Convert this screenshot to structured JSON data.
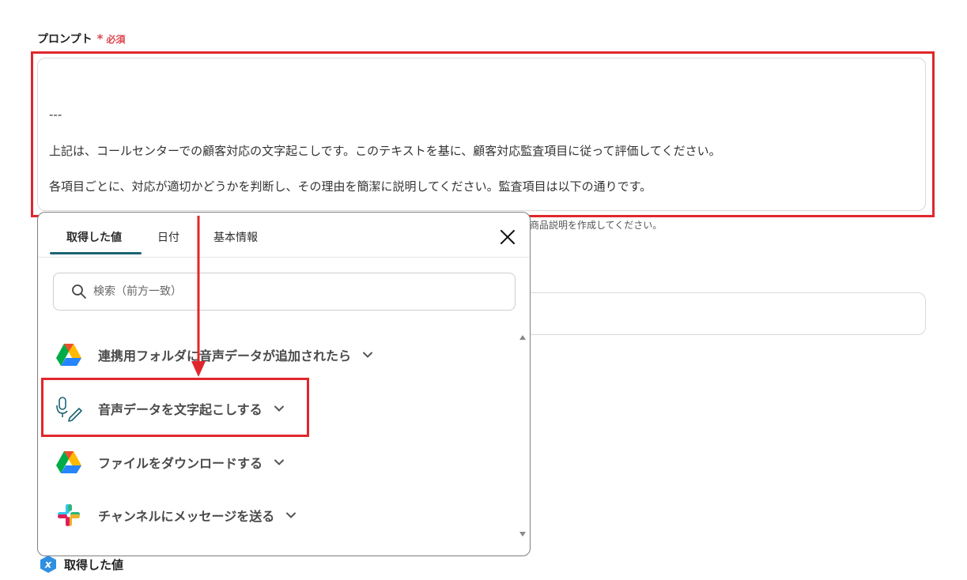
{
  "form": {
    "prompt_label": "プロンプト",
    "required_mark": "*",
    "required_text": "必須",
    "prompt_lines": [
      "---",
      "上記は、コールセンターでの顧客対応の文字起こしです。このテキストを基に、顧客対応監査項目に従って評価してください。",
      "各項目ごとに、対応が適切かどうかを判断し、その理由を簡潔に説明してください。監査項目は以下の通りです。"
    ],
    "hint_partial": "商品説明を作成してください。"
  },
  "popup": {
    "tabs": [
      {
        "label": "取得した値"
      },
      {
        "label": "日付"
      },
      {
        "label": "基本情報"
      }
    ],
    "search_placeholder": "検索（前方一致）",
    "items": [
      {
        "label": "連携用フォルダに音声データが追加されたら",
        "icon": "google-drive-icon"
      },
      {
        "label": "音声データを文字起こしする",
        "icon": "mic-pen-icon"
      },
      {
        "label": "ファイルをダウンロードする",
        "icon": "google-drive-icon"
      },
      {
        "label": "チャンネルにメッセージを送る",
        "icon": "slack-icon"
      }
    ]
  },
  "footer": {
    "obtained_label": "取得した値"
  },
  "colors": {
    "highlight": "#e0272c",
    "accent_tab": "#1b6474",
    "required": "#e0454f"
  }
}
